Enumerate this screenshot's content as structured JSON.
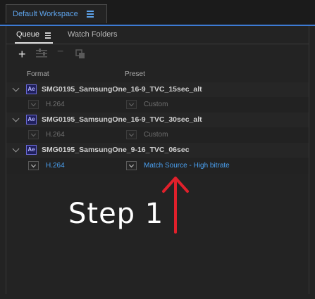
{
  "workspace": {
    "title": "Default Workspace",
    "menu_icon": "hamburger-menu-icon"
  },
  "panel": {
    "tabs": [
      {
        "label": "Queue",
        "active": true
      },
      {
        "label": "Watch Folders",
        "active": false
      }
    ],
    "toolbar": {
      "add": "+",
      "remove": "−"
    },
    "columns": {
      "format": "Format",
      "preset": "Preset"
    }
  },
  "queue": [
    {
      "source": "SMG0195_SamsungOne_16-9_TVC_15sec_alt",
      "format": "H.264",
      "preset": "Custom",
      "active": false
    },
    {
      "source": "SMG0195_SamsungOne_16-9_TVC_30sec_alt",
      "format": "H.264",
      "preset": "Custom",
      "active": false
    },
    {
      "source": "SMG0195_SamsungOne_9-16_TVC_06sec",
      "format": "H.264",
      "preset": "Match Source - High bitrate",
      "active": true
    }
  ],
  "ae_badge": "Ae",
  "annotation": {
    "text": "Step 1",
    "color": "#e0202b"
  },
  "colors": {
    "accent": "#5ea3ea",
    "active_text": "#4aa0f0",
    "background": "#232323"
  }
}
